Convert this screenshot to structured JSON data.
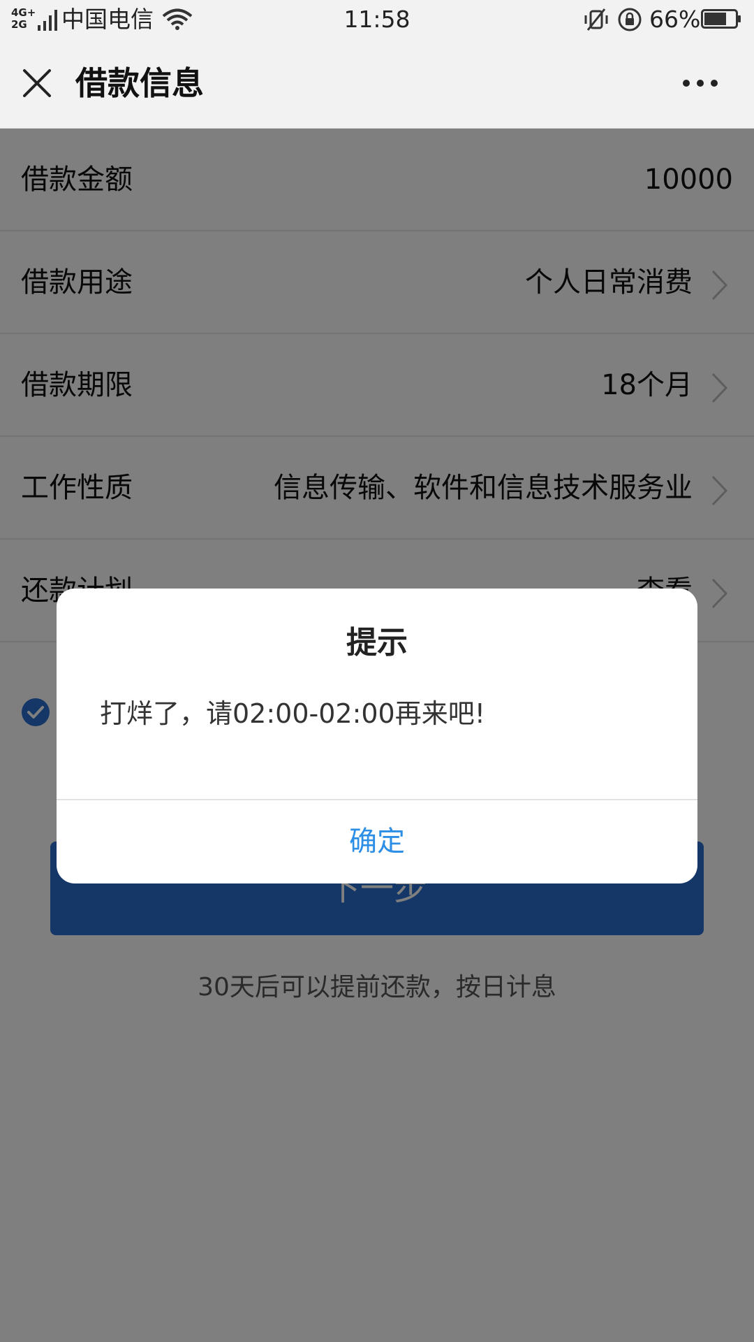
{
  "status_bar": {
    "network": "4G+\n2G",
    "carrier": "中国电信",
    "time": "11:58",
    "battery_percent": "66%",
    "icons": [
      "signal-icon",
      "wifi-icon",
      "mute-icon",
      "rotation-lock-icon",
      "battery-icon"
    ]
  },
  "titlebar": {
    "title": "借款信息",
    "close_icon": "close-icon",
    "more_icon": "more-icon"
  },
  "rows": [
    {
      "label": "借款金额",
      "value": "10000",
      "has_arrow": false
    },
    {
      "label": "借款用途",
      "value": "个人日常消费",
      "has_arrow": true
    },
    {
      "label": "借款期限",
      "value": "18个月",
      "has_arrow": true
    },
    {
      "label": "工作性质",
      "value": "信息传输、软件和信息技术服务业",
      "has_arrow": true
    },
    {
      "label": "还款计划",
      "value": "查看",
      "has_arrow": true
    }
  ],
  "next_button": {
    "label": "下一步"
  },
  "note": "30天后可以提前还款，按日计息",
  "dialog": {
    "title": "提示",
    "message": "打烊了，请02:00-02:00再来吧!",
    "ok_label": "确定"
  },
  "colors": {
    "accent_blue": "#2a6fcf",
    "link_blue": "#2d8ee6",
    "bar_bg": "#f2f2f2"
  }
}
